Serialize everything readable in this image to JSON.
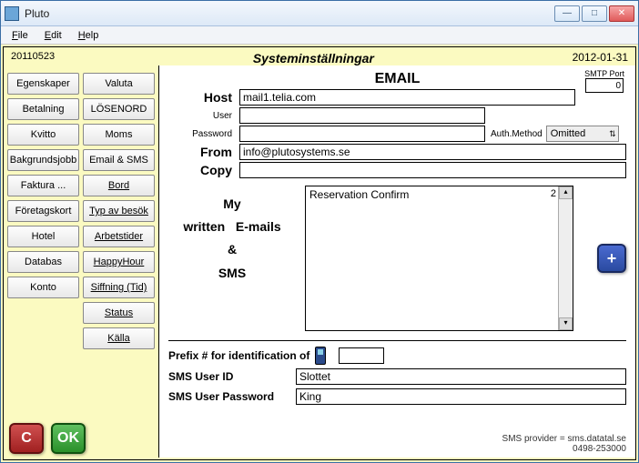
{
  "window": {
    "title": "Pluto"
  },
  "menu": {
    "file": "File",
    "edit": "Edit",
    "help": "Help"
  },
  "header": {
    "stamp": "20110523",
    "title": "Systeminställningar",
    "date": "2012-01-31"
  },
  "sidebar": {
    "col1": [
      "Egenskaper",
      "Betalning",
      "Kvitto",
      "Bakgrundsjobb",
      "Faktura ...",
      "Företagskort",
      "Hotel",
      "Databas",
      "Konto"
    ],
    "col2": [
      "Valuta",
      "LÖSENORD",
      "Moms",
      "Email & SMS",
      "Bord",
      "Typ av besök",
      "Arbetstider",
      "HappyHour",
      "Siffning (Tid)",
      "Status",
      "Källa"
    ],
    "col2_underline_from": 4
  },
  "email": {
    "section": "EMAIL",
    "smtp_label": "SMTP Port",
    "smtp_port": "0",
    "host_label": "Host",
    "host": "mail1.telia.com",
    "user_label": "User",
    "user": "",
    "password_label": "Password",
    "password": "",
    "auth_label": "Auth.Method",
    "auth_value": "Omitted",
    "from_label": "From",
    "from": "info@plutosystems.se",
    "copy_label": "Copy",
    "copy": ""
  },
  "templates": {
    "line1": "My",
    "line2": "written   E-mails",
    "line3": "&",
    "line4": "SMS",
    "list_item": "Reservation Confirm",
    "list_count": "2"
  },
  "sms": {
    "prefix_label": "Prefix # for identification of",
    "prefix_value": "",
    "user_label": "SMS User ID",
    "user": "Slottet",
    "pass_label": "SMS User Password",
    "pass": "King"
  },
  "footer": {
    "cancel": "C",
    "ok": "OK",
    "provider1": "SMS provider = sms.datatal.se",
    "provider2": "0498-253000"
  }
}
